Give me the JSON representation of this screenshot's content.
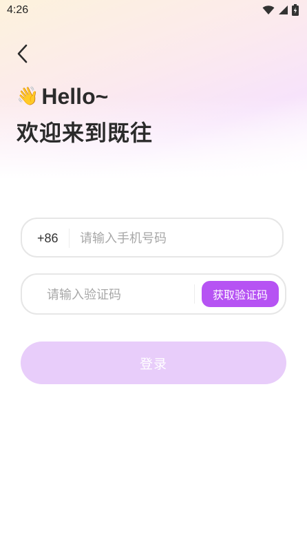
{
  "status_bar": {
    "time": "4:26",
    "icons": [
      "wifi-icon",
      "cellular-signal-icon",
      "battery-charging-icon"
    ]
  },
  "header": {
    "back_icon": "chevron-left-icon",
    "wave_emoji": "👋",
    "hello": "Hello~",
    "welcome": "欢迎来到既往"
  },
  "phone": {
    "country_code": "+86",
    "value": "",
    "placeholder": "请输入手机号码"
  },
  "code": {
    "value": "",
    "placeholder": "请输入验证码",
    "get_code_label": "获取验证码"
  },
  "login": {
    "label": "登录"
  },
  "colors": {
    "accent": "#b653f3",
    "login_disabled": "#e8cdfa",
    "title_text": "#2b2b2b"
  }
}
